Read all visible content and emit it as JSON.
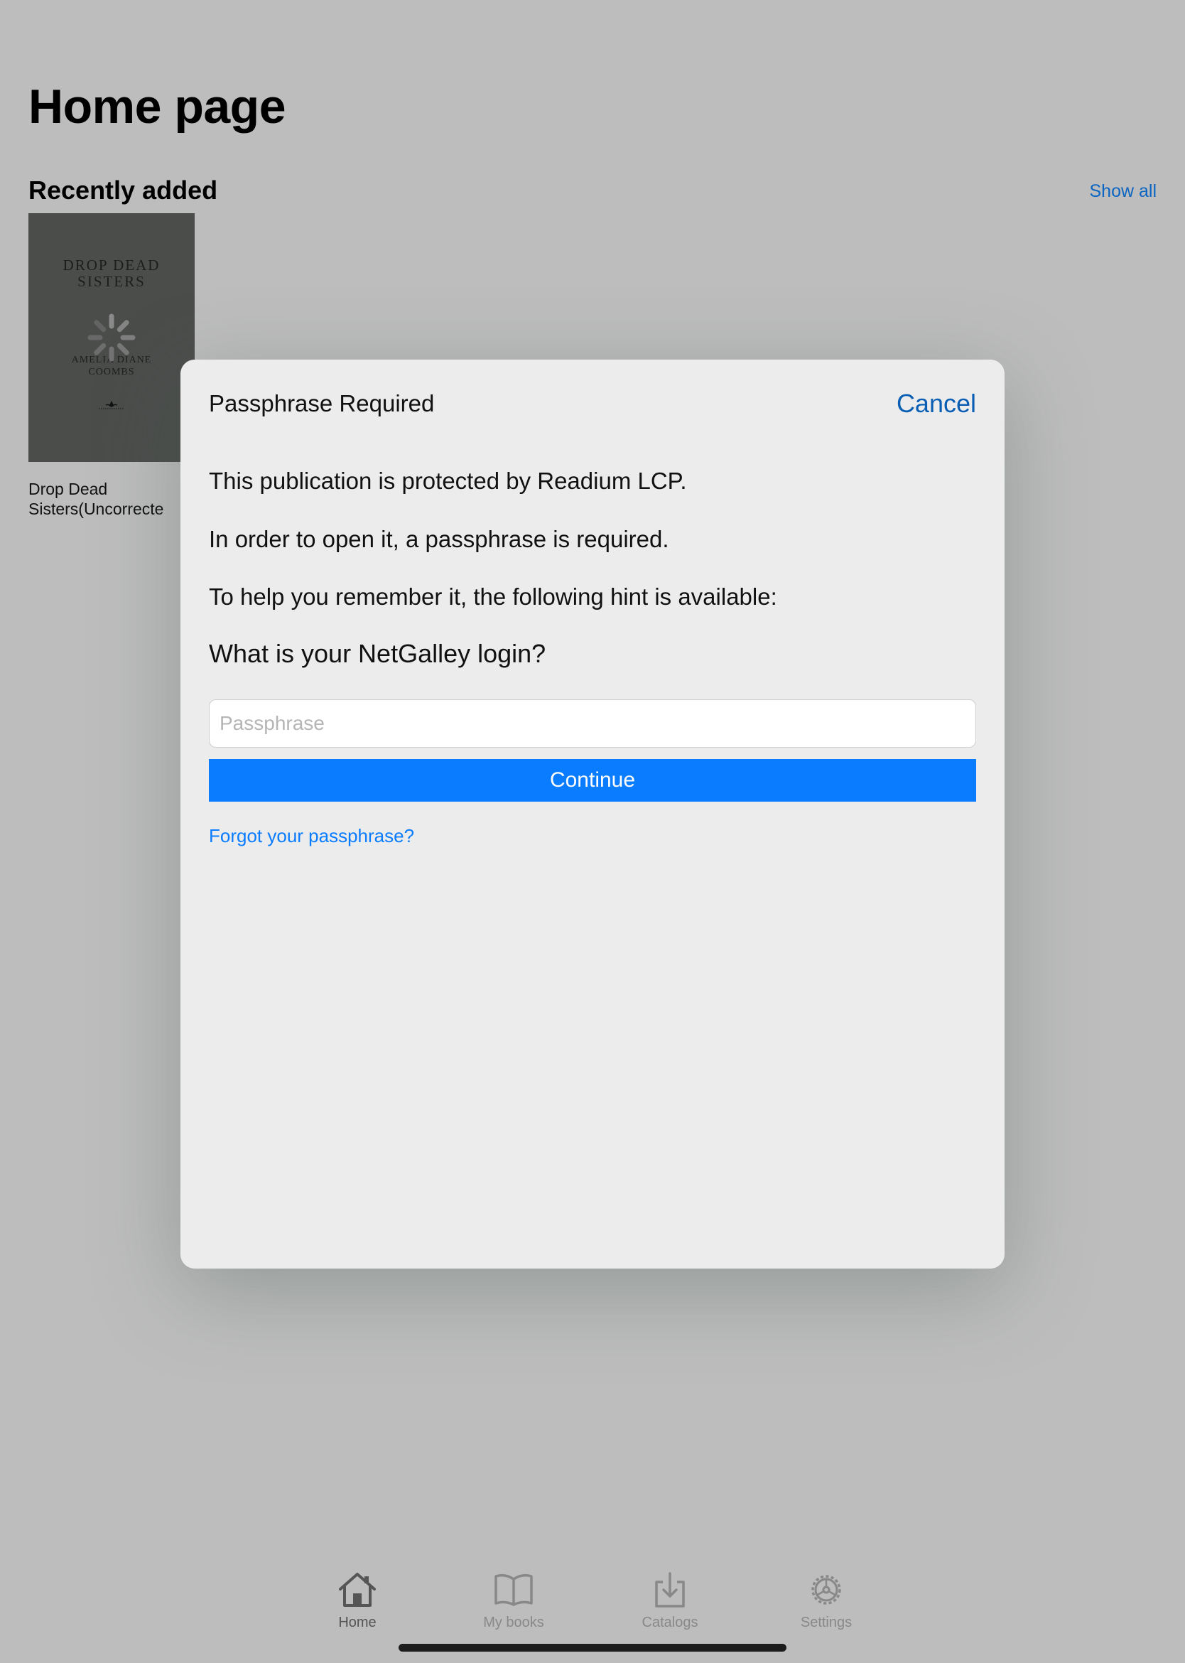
{
  "home": {
    "title": "Home page",
    "recently_added": "Recently added",
    "show_all": "Show all",
    "book": {
      "title": "Drop Dead Sisters(Uncorrected",
      "title_line1": "Drop Dead",
      "title_line2": "Sisters(Uncorrecte",
      "cover_title_line1": "DROP DEAD",
      "cover_title_line2": "SISTERS",
      "cover_author_line1": "AMELIA DIANE",
      "cover_author_line2": "COOMBS"
    }
  },
  "dialog": {
    "title": "Passphrase Required",
    "cancel": "Cancel",
    "line1": "This publication is protected by Readium LCP.",
    "line2": "In order to open it, a passphrase is required.",
    "line3": "To help you remember it, the following hint is available:",
    "hint": "What is your NetGalley login?",
    "input_placeholder": "Passphrase",
    "input_value": "",
    "continue": "Continue",
    "forgot": "Forgot your passphrase?"
  },
  "tabbar": {
    "tabs": [
      {
        "label": "Home",
        "icon": "home-icon",
        "active": true
      },
      {
        "label": "My books",
        "icon": "book-icon",
        "active": false
      },
      {
        "label": "Catalogs",
        "icon": "download-tray-icon",
        "active": false
      },
      {
        "label": "Settings",
        "icon": "gear-icon",
        "active": false
      }
    ]
  },
  "colors": {
    "accent": "#0a7cff",
    "link": "#0a5fb4",
    "backdrop": "#bdbdbd",
    "dialog_bg": "#ececec"
  }
}
